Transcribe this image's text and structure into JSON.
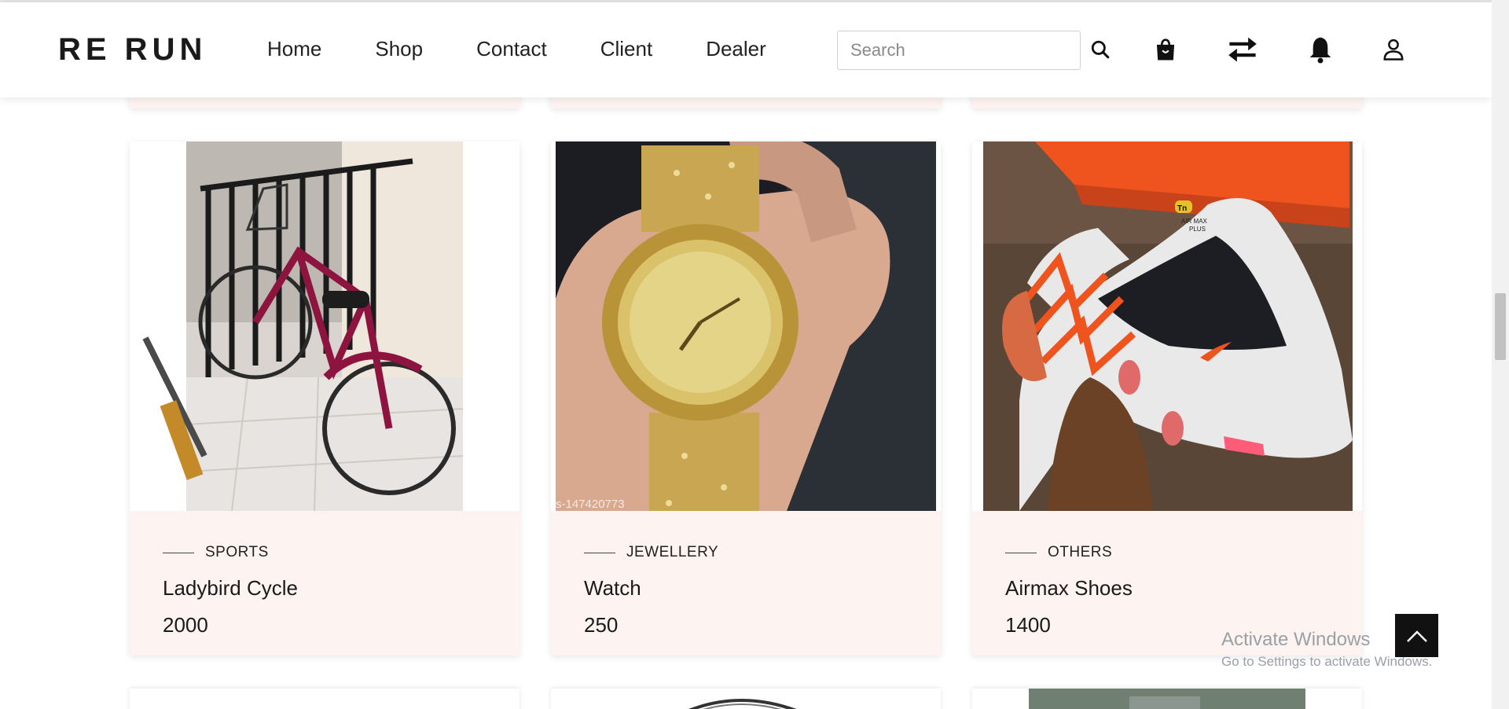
{
  "header": {
    "logo": "RE RUN",
    "nav": [
      "Home",
      "Shop",
      "Contact",
      "Client",
      "Dealer"
    ],
    "search_placeholder": "Search",
    "icons": [
      "search-icon",
      "shopping-bag-icon",
      "exchange-arrows-icon",
      "bell-icon",
      "user-icon"
    ]
  },
  "products": [
    {
      "category": "SPORTS",
      "name": "Ladybird Cycle",
      "price": "2000"
    },
    {
      "category": "JEWELLERY",
      "name": "Watch",
      "price": "250",
      "image_text": "s-147420773"
    },
    {
      "category": "OTHERS",
      "name": "Airmax Shoes",
      "price": "1400",
      "image_text": [
        "Tn",
        "AIR MAX",
        "PLUS"
      ]
    }
  ],
  "watermark": {
    "title": "Activate Windows",
    "subtitle": "Go to Settings to activate Windows."
  },
  "colors": {
    "card_bg": "#fdf3f1",
    "accent_shoe": "#ff5a1f"
  }
}
